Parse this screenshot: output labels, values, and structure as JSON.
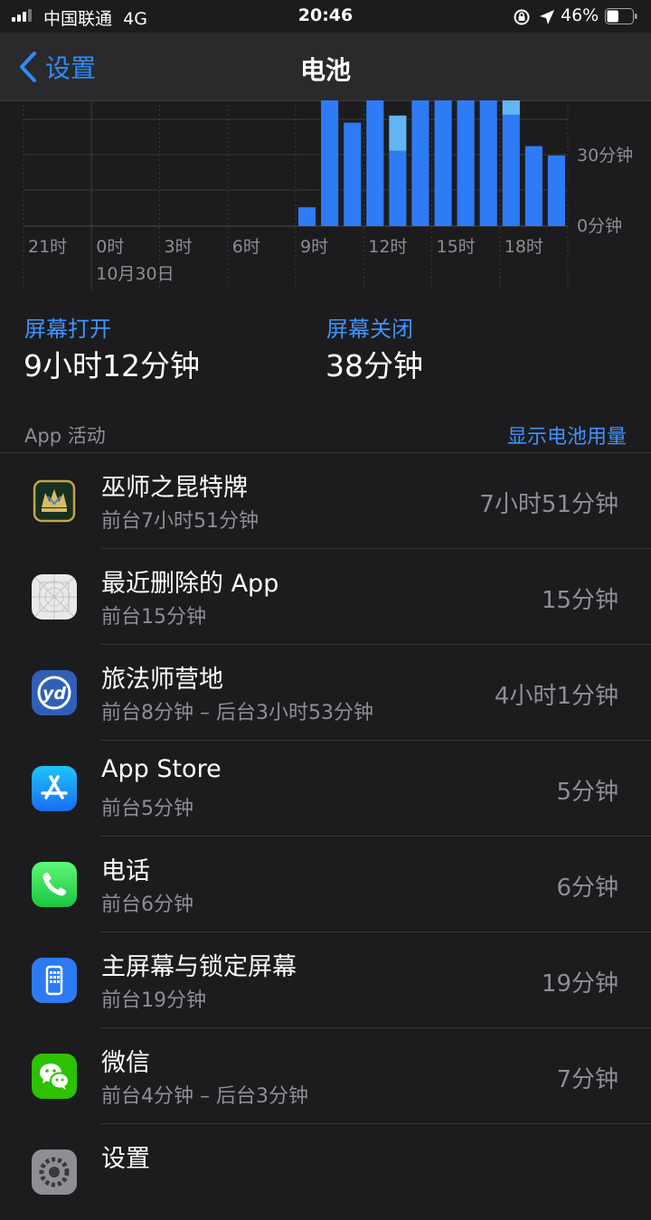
{
  "status": {
    "carrier": "中国联通",
    "network": "4G",
    "time": "20:46",
    "battery_percent": "46%",
    "battery_level": 0.46
  },
  "nav": {
    "back_label": "设置",
    "title": "电池"
  },
  "chart_data": {
    "type": "bar",
    "x_tick_labels": [
      "21时",
      "0时",
      "3时",
      "6时",
      "9时",
      "12时",
      "15时",
      "18时"
    ],
    "date_label": "10月30日",
    "y_tick_labels": [
      "30分钟",
      "0分钟"
    ],
    "ylim": [
      0,
      60
    ],
    "bar_hours": [
      "8时",
      "9时",
      "10时",
      "11时",
      "12时",
      "13时",
      "14时",
      "15时",
      "16时",
      "17时",
      "18时",
      "19时"
    ],
    "series": [
      {
        "values": [
          8,
          60,
          44,
          60,
          32,
          60,
          60,
          60,
          60,
          60,
          34,
          30
        ]
      },
      {
        "values": [
          0,
          0,
          0,
          0,
          15,
          0,
          0,
          0,
          0,
          8,
          0,
          0
        ]
      }
    ],
    "colors": [
      "#2e7bf6",
      "#64b5f6"
    ],
    "grid": true
  },
  "screen": {
    "on_label": "屏幕打开",
    "on_value": "9小时12分钟",
    "off_label": "屏幕关闭",
    "off_value": "38分钟"
  },
  "activity": {
    "title": "App 活动",
    "show_usage": "显示电池用量",
    "apps": [
      {
        "icon": "gwent-icon",
        "name": "巫师之昆特牌",
        "detail": "前台7小时51分钟",
        "duration": "7小时51分钟"
      },
      {
        "icon": "deleted-app-icon",
        "name": "最近删除的 App",
        "detail": "前台15分钟",
        "duration": "15分钟"
      },
      {
        "icon": "lvfashi-icon",
        "name": "旅法师营地",
        "detail": "前台8分钟 – 后台3小时53分钟",
        "duration": "4小时1分钟"
      },
      {
        "icon": "app-store-icon",
        "name": "App Store",
        "detail": "前台5分钟",
        "duration": "5分钟"
      },
      {
        "icon": "phone-icon",
        "name": "电话",
        "detail": "前台6分钟",
        "duration": "6分钟"
      },
      {
        "icon": "home-lock-screen-icon",
        "name": "主屏幕与锁定屏幕",
        "detail": "前台19分钟",
        "duration": "19分钟"
      },
      {
        "icon": "wechat-icon",
        "name": "微信",
        "detail": "前台4分钟 – 后台3分钟",
        "duration": "7分钟"
      },
      {
        "icon": "settings-icon",
        "name": "设置",
        "detail": "",
        "duration": ""
      }
    ]
  }
}
